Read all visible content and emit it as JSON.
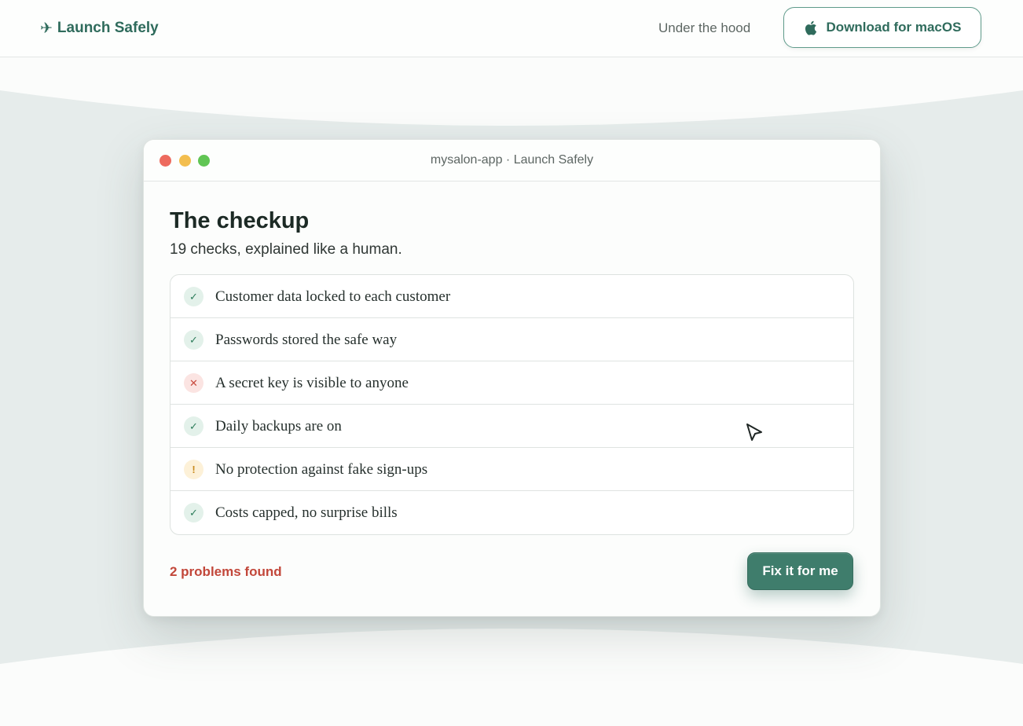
{
  "nav": {
    "brand_icon": "✈",
    "brand_name": "Launch Safely",
    "link_under_hood": "Under the hood",
    "download_label": "Download for macOS",
    "download_icon": "apple-icon"
  },
  "window": {
    "title": "mysalon-app · Launch Safely",
    "heading": "The checkup",
    "subheading": "19 checks, explained like a human.",
    "checks": [
      {
        "label": "Customer data locked to each customer",
        "status": "pass",
        "icon": "✓"
      },
      {
        "label": "Passwords stored the safe way",
        "status": "pass",
        "icon": "✓"
      },
      {
        "label": "A secret key is visible to anyone",
        "status": "fail",
        "icon": "✕"
      },
      {
        "label": "Daily backups are on",
        "status": "pass",
        "icon": "✓"
      },
      {
        "label": "No protection against fake sign-ups",
        "status": "warn",
        "icon": "!"
      },
      {
        "label": "Costs capped, no surprise bills",
        "status": "pass",
        "icon": "✓"
      }
    ],
    "problems_text": "2 problems found",
    "fix_button": "Fix it for me"
  },
  "colors": {
    "brand": "#2f6b5c",
    "pass": "#2e7d5b",
    "fail": "#c84a3e",
    "warn": "#c98b1f",
    "problem_text": "#c2473a",
    "primary_button": "#3f7d6c"
  }
}
